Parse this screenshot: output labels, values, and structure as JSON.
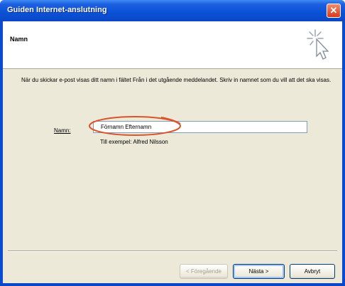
{
  "window": {
    "title": "Guiden Internet-anslutning",
    "close_glyph": "✕"
  },
  "header": {
    "title": "Namn",
    "icon": "wizard-cursor-icon"
  },
  "body": {
    "instruction": "När du skickar e-post visas ditt namn i fältet Från i det utgående meddelandet. Skriv in namnet som du vill att det ska visas.",
    "name_label": "Namn:",
    "name_value": "Förnamn Efternamn",
    "example": "Till exempel: Alfred Nilsson"
  },
  "buttons": {
    "back_label": "< Föregående",
    "next_label": "Nästa >",
    "cancel_label": "Avbryt"
  },
  "colors": {
    "titlebar": "#0b53d8",
    "client_bg": "#ece9d8",
    "highlight_ellipse": "#d9542b"
  }
}
